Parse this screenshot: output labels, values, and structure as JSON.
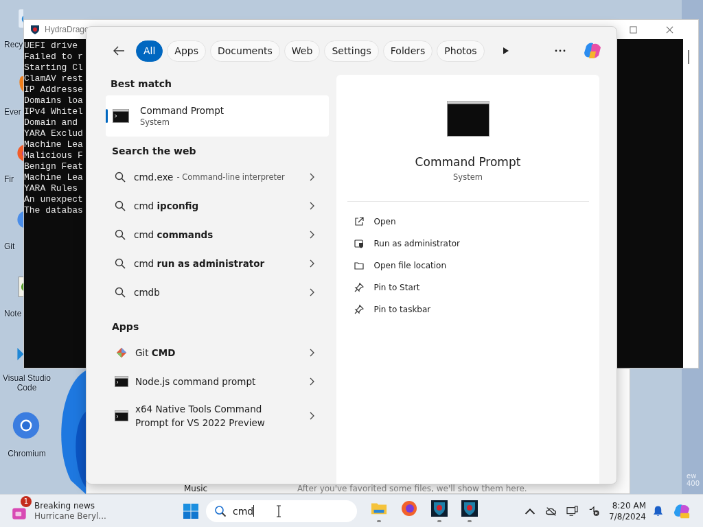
{
  "desktop_icons": [
    {
      "label": "Recy",
      "kind": "recycle"
    },
    {
      "label": "Ever",
      "kind": "everything"
    },
    {
      "label": "Fir",
      "kind": "firefox"
    },
    {
      "label": "Git",
      "kind": "git"
    },
    {
      "label": "Note",
      "kind": "notepad"
    },
    {
      "label": "Visual Studio Code",
      "kind": "vscode"
    },
    {
      "label": "Chromium",
      "kind": "chromium"
    }
  ],
  "console_window": {
    "title": "HydraDrago",
    "lines": [
      "UEFI drive",
      "Failed to r",
      "Starting Cl",
      "ClamAV rest",
      "IP Addresse",
      "Domains loa",
      "IPv4 Whitel",
      "Domain and",
      "YARA Exclud",
      "Machine Lea",
      "Malicious F",
      "Benign Feat",
      "Machine Lea",
      "YARA Rules",
      "An unexpect",
      "The databas"
    ]
  },
  "background_window": {
    "folder": "Music",
    "message": "After you've favorited some files, we'll show them here."
  },
  "search_panel": {
    "tabs": [
      {
        "label": "All",
        "selected": true
      },
      {
        "label": "Apps",
        "selected": false
      },
      {
        "label": "Documents",
        "selected": false
      },
      {
        "label": "Web",
        "selected": false
      },
      {
        "label": "Settings",
        "selected": false
      },
      {
        "label": "Folders",
        "selected": false
      },
      {
        "label": "Photos",
        "selected": false
      }
    ],
    "best_match": {
      "heading": "Best match",
      "title": "Command Prompt",
      "subtitle": "System",
      "selected": true
    },
    "web": {
      "heading": "Search the web",
      "results": [
        {
          "text": "cmd.exe",
          "detail": "- Command-line interpreter"
        },
        {
          "text": "cmd **ipconfig**"
        },
        {
          "text": "cmd **commands**"
        },
        {
          "text": "cmd **run as administrator**"
        },
        {
          "text": "cmdb"
        }
      ]
    },
    "apps": {
      "heading": "Apps",
      "items": [
        {
          "name": "Git **CMD**",
          "kind": "git"
        },
        {
          "name": "Node.js command prompt",
          "kind": "console"
        },
        {
          "name": "x64 Native Tools Command Prompt for VS 2022 Preview",
          "kind": "console"
        }
      ]
    },
    "preview": {
      "title": "Command Prompt",
      "subtitle": "System",
      "actions": [
        {
          "label": "Open",
          "kind": "open"
        },
        {
          "label": "Run as administrator",
          "kind": "admin"
        },
        {
          "label": "Open file location",
          "kind": "folder"
        },
        {
          "label": "Pin to Start",
          "kind": "pin"
        },
        {
          "label": "Pin to taskbar",
          "kind": "pin"
        }
      ]
    }
  },
  "taskbar": {
    "news": {
      "badge": "1",
      "title": "Breaking news",
      "subtitle": "Hurricane Beryl..."
    },
    "search": {
      "value": "cmd"
    },
    "apps": [
      {
        "kind": "explorer",
        "running": true
      },
      {
        "kind": "firefox",
        "running": false
      },
      {
        "kind": "shield",
        "running": true
      },
      {
        "kind": "shield",
        "running": true
      }
    ],
    "clock": {
      "time": "8:20 AM",
      "date": "7/8/2024"
    }
  },
  "edition_text": [
    "ew",
    "400"
  ]
}
